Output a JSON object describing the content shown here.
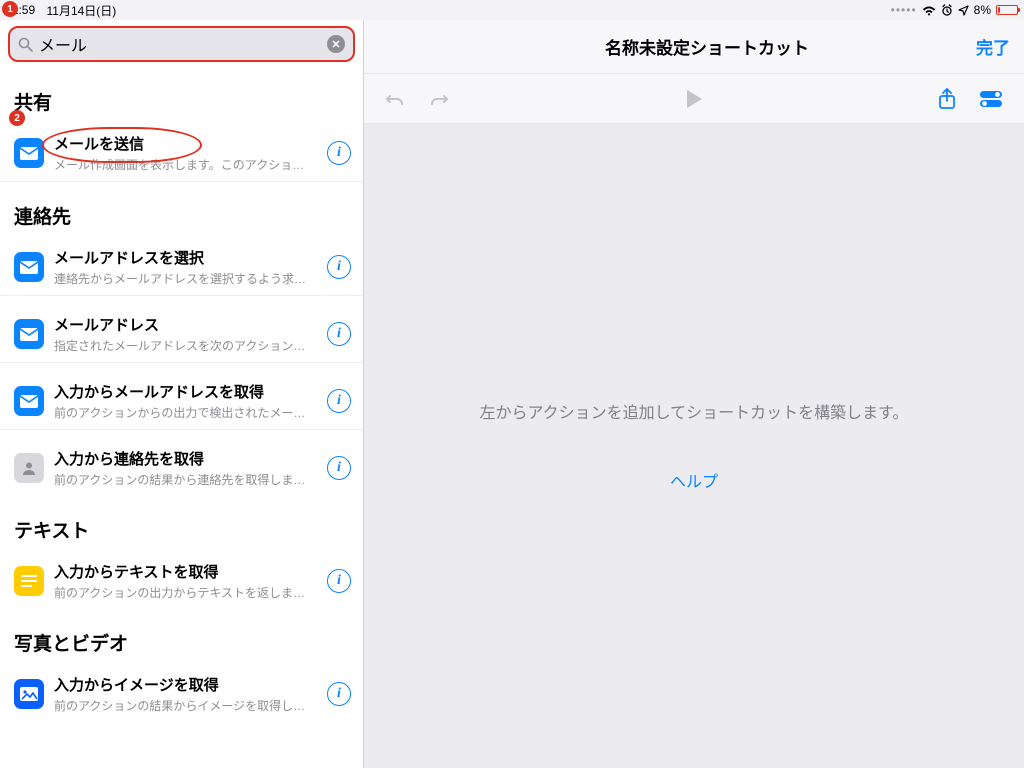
{
  "status": {
    "time": "11:59",
    "date": "11月14日(日)",
    "battery_pct": "8%"
  },
  "annotations": {
    "badge1": "1",
    "badge2": "2"
  },
  "search": {
    "query": "メール"
  },
  "sections": [
    {
      "title": "共有",
      "items": [
        {
          "icon": "mail",
          "color": "blue",
          "title": "メールを送信",
          "subtitle": "メール作成画面を表示します。このアクショ…"
        }
      ]
    },
    {
      "title": "連絡先",
      "items": [
        {
          "icon": "mail",
          "color": "blue",
          "title": "メールアドレスを選択",
          "subtitle": "連絡先からメールアドレスを選択するよう求…"
        },
        {
          "icon": "mail",
          "color": "blue",
          "title": "メールアドレス",
          "subtitle": "指定されたメールアドレスを次のアクション…"
        },
        {
          "icon": "mail",
          "color": "blue",
          "title": "入力からメールアドレスを取得",
          "subtitle": "前のアクションからの出力で検出されたメー…"
        },
        {
          "icon": "contact",
          "color": "grey",
          "title": "入力から連絡先を取得",
          "subtitle": "前のアクションの結果から連絡先を取得しま…"
        }
      ]
    },
    {
      "title": "テキスト",
      "items": [
        {
          "icon": "text",
          "color": "yellow",
          "title": "入力からテキストを取得",
          "subtitle": "前のアクションの出力からテキストを返しま…"
        }
      ]
    },
    {
      "title": "写真とビデオ",
      "items": [
        {
          "icon": "image",
          "color": "imageblue",
          "title": "入力からイメージを取得",
          "subtitle": "前のアクションの結果からイメージを取得し…"
        }
      ]
    }
  ],
  "main": {
    "title": "名称未設定ショートカット",
    "done": "完了",
    "placeholder_line": "左からアクションを追加してショートカットを構築します。",
    "help": "ヘルプ"
  }
}
